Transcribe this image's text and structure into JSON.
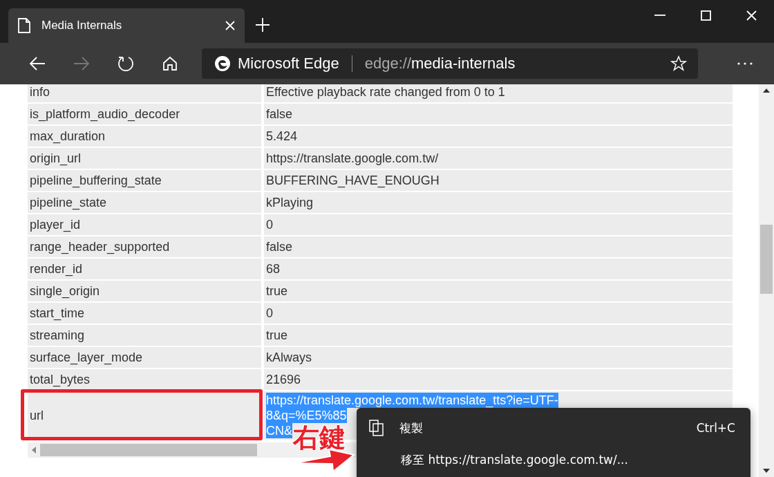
{
  "window": {
    "tab_title": "Media Internals"
  },
  "address_bar": {
    "site_name": "Microsoft Edge",
    "url_prefix": "edge://",
    "url_path": "media-internals"
  },
  "table": {
    "rows": [
      {
        "key": "info",
        "value": [
          "Effective playback rate changed from 0 to 1"
        ],
        "selected": false
      },
      {
        "key": "is_platform_audio_decoder",
        "value": [
          "false"
        ],
        "selected": false
      },
      {
        "key": "max_duration",
        "value": [
          "5.424"
        ],
        "selected": false
      },
      {
        "key": "origin_url",
        "value": [
          "https://translate.google.com.tw/"
        ],
        "selected": false
      },
      {
        "key": "pipeline_buffering_state",
        "value": [
          "BUFFERING_HAVE_ENOUGH"
        ],
        "selected": false
      },
      {
        "key": "pipeline_state",
        "value": [
          "kPlaying"
        ],
        "selected": false
      },
      {
        "key": "player_id",
        "value": [
          "0"
        ],
        "selected": false
      },
      {
        "key": "range_header_supported",
        "value": [
          "false"
        ],
        "selected": false
      },
      {
        "key": "render_id",
        "value": [
          "68"
        ],
        "selected": false
      },
      {
        "key": "single_origin",
        "value": [
          "true"
        ],
        "selected": false
      },
      {
        "key": "start_time",
        "value": [
          "0"
        ],
        "selected": false
      },
      {
        "key": "streaming",
        "value": [
          "true"
        ],
        "selected": false
      },
      {
        "key": "surface_layer_mode",
        "value": [
          "kAlways"
        ],
        "selected": false
      },
      {
        "key": "total_bytes",
        "value": [
          "21696"
        ],
        "selected": false
      },
      {
        "key": "url",
        "value": [
          "https://translate.google.com.tw/translate_tts?ie=UTF-",
          "8&q=%E5%85",
          "CN&"
        ],
        "selected": true
      }
    ]
  },
  "context_menu": {
    "items": [
      {
        "kind": "copy",
        "label": "複製",
        "shortcut": "Ctrl+C"
      },
      {
        "kind": "goto",
        "label": "移至 https://translate.google.com.tw/..."
      }
    ]
  },
  "annotation": {
    "label": "右鍵"
  }
}
